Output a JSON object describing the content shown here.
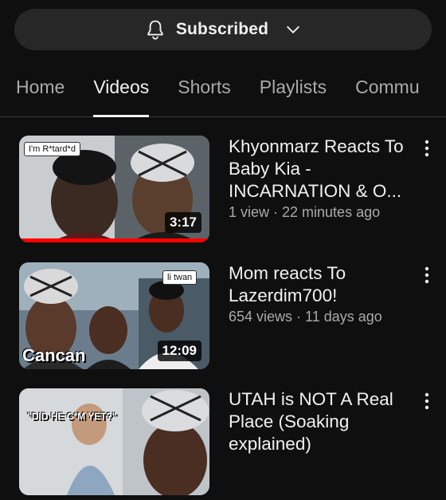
{
  "subscribe": {
    "label": "Subscribed"
  },
  "tabs": [
    {
      "label": "Home",
      "active": false
    },
    {
      "label": "Videos",
      "active": true
    },
    {
      "label": "Shorts",
      "active": false
    },
    {
      "label": "Playlists",
      "active": false
    },
    {
      "label": "Commu",
      "active": false
    }
  ],
  "videos": [
    {
      "title": "Khyonmarz Reacts To Baby Kia - INCARNATION & O...",
      "meta": "1 view · 22 minutes ago",
      "duration": "3:17",
      "overlay_text": "I'm R*tard*d",
      "watched_fraction": 1.0
    },
    {
      "title": "Mom reacts To Lazerdim700!",
      "meta": "654 views · 11 days ago",
      "duration": "12:09",
      "overlay_text": "li twan",
      "overlay_big": "Cancan"
    },
    {
      "title": "UTAH is NOT A Real Place (Soaking explained)",
      "meta": "",
      "overlay_text": "\"DID HE C*M YET?\""
    }
  ],
  "colors": {
    "background": "#0f0f0f",
    "progress": "#ff0000",
    "chip": "#272727"
  }
}
